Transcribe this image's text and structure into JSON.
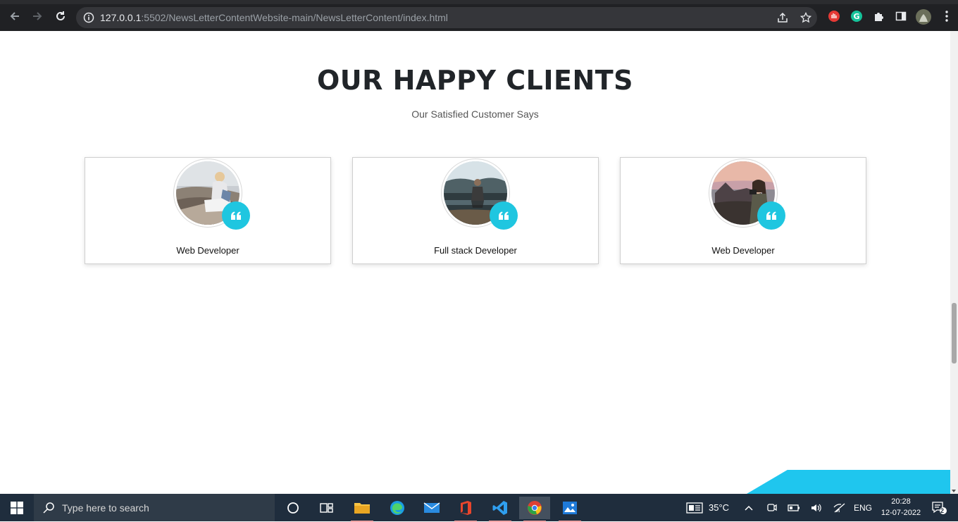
{
  "browser": {
    "url_host": "127.0.0.1",
    "url_rest": ":5502/NewsLetterContentWebsite-main/NewsLetterContent/index.html"
  },
  "section": {
    "title": "OUR HAPPY CLIENTS",
    "subtitle": "Our Satisfied Customer Says"
  },
  "cards": [
    {
      "role": "Web Developer",
      "avatar": "woman-on-hill-avatar"
    },
    {
      "role": "Full stack Developer",
      "avatar": "man-in-lake-avatar"
    },
    {
      "role": "Web Developer",
      "avatar": "woman-with-camera-avatar"
    }
  ],
  "colors": {
    "accent": "#1fc6e0",
    "title": "#212529",
    "chrome": "#202124",
    "taskbar": "#1f2d3d"
  },
  "taskbar": {
    "search_placeholder": "Type here to search",
    "temperature": "35°C",
    "language": "ENG",
    "time": "20:28",
    "date": "12-07-2022",
    "notification_count": "2"
  }
}
